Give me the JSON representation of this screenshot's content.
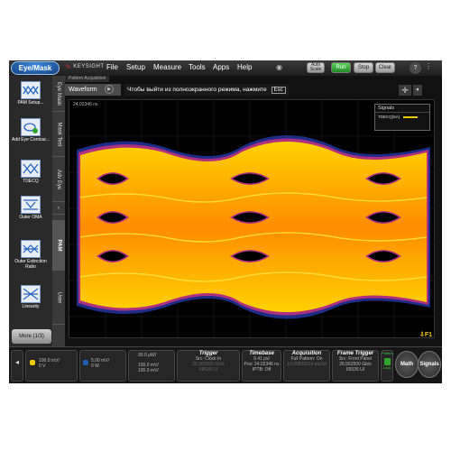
{
  "topbar": {
    "app_button": "Eye/Mask",
    "brand": "KEYSIGHT",
    "menus": [
      "File",
      "Setup",
      "Measure",
      "Tools",
      "Apps",
      "Help"
    ],
    "auto_scale": "Auto Scale",
    "run": "Run",
    "stop": "Stop",
    "clear": "Clear",
    "help": "?",
    "more": "⋮"
  },
  "sidebar": {
    "items": [
      {
        "label": "PAM Setup..."
      },
      {
        "label": "Add Eye Contour..."
      },
      {
        "label": "TDECQ"
      },
      {
        "label": "Outer OMA"
      },
      {
        "label": "Outer Extinction Ratio"
      },
      {
        "label": "Linearity"
      }
    ],
    "more": "More (1/3)"
  },
  "vtabs": [
    "Eye Mask",
    "Mask Test",
    "Adv Eye",
    "PAM",
    "User"
  ],
  "waveform": {
    "pattern_tab": "Pattern Acquisition",
    "tab": "Waveform",
    "fullscreen_msg": "Чтобы выйти из полноэкранного режима, нажмите",
    "esc": "Esc",
    "timestamp": "24.02346 ns",
    "signals_title": "Signals",
    "signal_name": "TDECQ(5A)",
    "marker": "F1"
  },
  "bottom": {
    "ch_scale": "100.0 mV/",
    "ch_offset": "0 V",
    "ch2_scale": "5.00 mV/",
    "ch2_offset": "0 W",
    "src_scale": "99.0 µW/",
    "src_line2": "100.0 mV/",
    "src_line3": "100.0 mV/",
    "trigger_title": "Trigger",
    "trigger_src": "Src: Clock In",
    "trigger_rate": "26.562500 Gb/s",
    "trigger_ui": "65535 UI",
    "timebase_title": "Timebase",
    "timebase_scale": "9.41 ps/",
    "timebase_pos": "Pos: 24.02346 ns",
    "timebase_iptb": "IPTB: Off",
    "acq_title": "Acquisition",
    "acq_full": "Full Pattern: On",
    "acq_rate": "10.99800524 pts/UI",
    "frame_title": "Frame Trigger",
    "frame_src": "Src: Front Panel",
    "frame_rate": "26.562500 Gb/s",
    "frame_ui": "65535 UI",
    "pattern_label": "Pattern",
    "lock_label": "Lock",
    "math": "Math",
    "signals": "Signals"
  },
  "colors": {
    "accent": "#1e5fb4",
    "run": "#2fa52f",
    "signal": "#e8c800",
    "eye_hot": "#ff9a00",
    "eye_edge": "#b03080"
  }
}
